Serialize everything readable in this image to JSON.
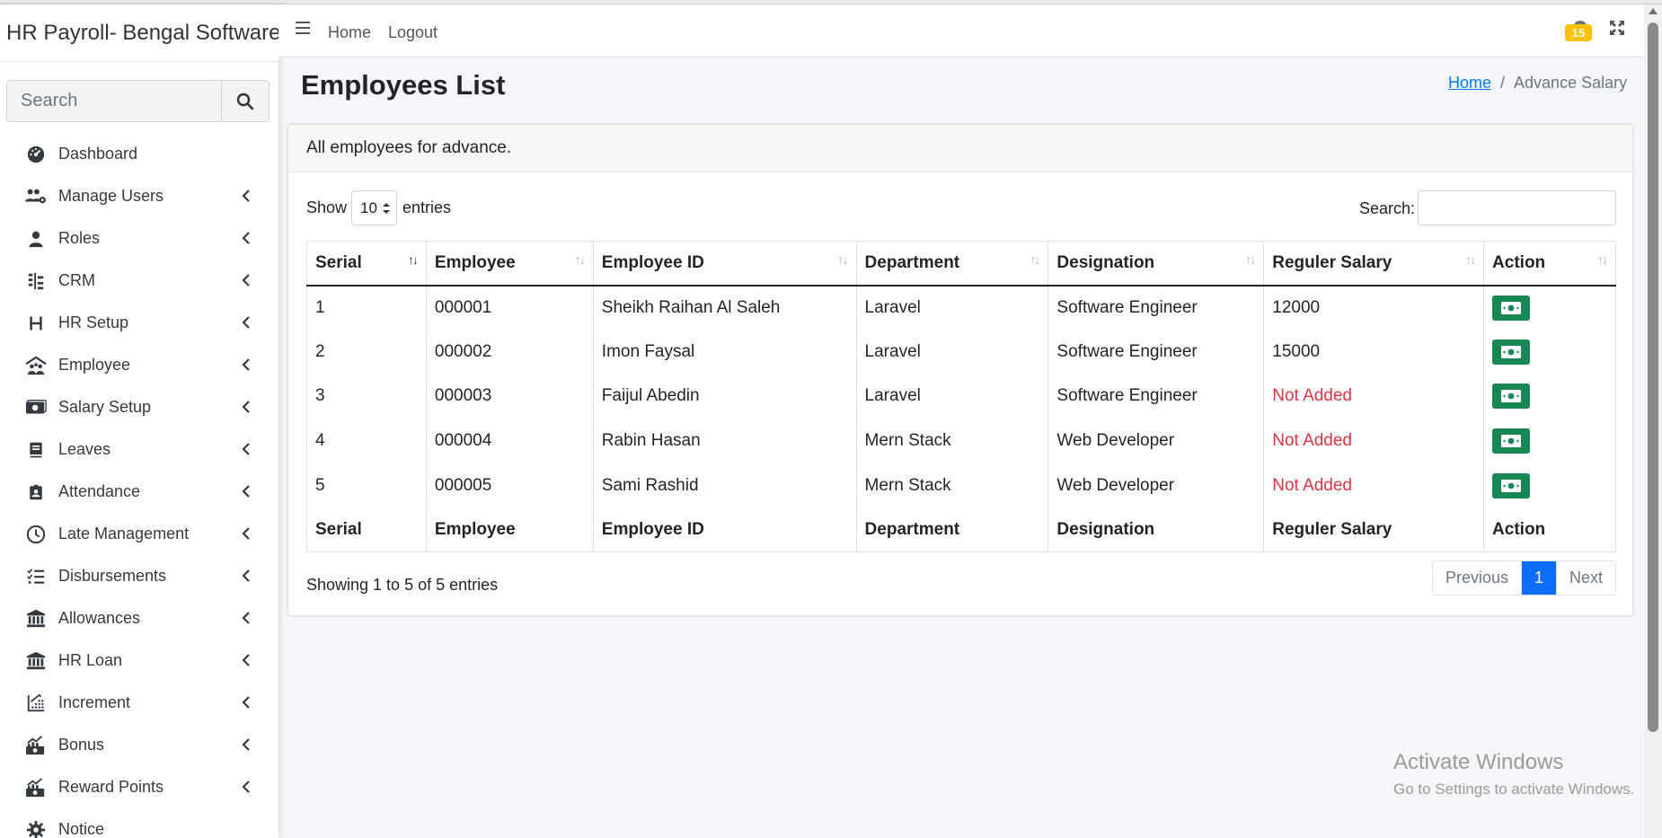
{
  "app": {
    "brand": "HR Payroll- Bengal Software"
  },
  "sidebar": {
    "search_placeholder": "Search",
    "items": [
      {
        "label": "Dashboard",
        "icon": "dashboard-icon",
        "has_submenu": false
      },
      {
        "label": "Manage Users",
        "icon": "users-icon",
        "has_submenu": true
      },
      {
        "label": "Roles",
        "icon": "user-icon",
        "has_submenu": true
      },
      {
        "label": "CRM",
        "icon": "sliders-icon",
        "has_submenu": true
      },
      {
        "label": "HR Setup",
        "icon": "h-icon",
        "has_submenu": true
      },
      {
        "label": "Employee",
        "icon": "people-roof-icon",
        "has_submenu": true
      },
      {
        "label": "Salary Setup",
        "icon": "money-bill-icon",
        "has_submenu": true
      },
      {
        "label": "Leaves",
        "icon": "book-icon",
        "has_submenu": true
      },
      {
        "label": "Attendance",
        "icon": "id-badge-icon",
        "has_submenu": true
      },
      {
        "label": "Late Management",
        "icon": "clock-icon",
        "has_submenu": true
      },
      {
        "label": "Disbursements",
        "icon": "list-check-icon",
        "has_submenu": true
      },
      {
        "label": "Allowances",
        "icon": "bank-icon",
        "has_submenu": true
      },
      {
        "label": "HR Loan",
        "icon": "bank-icon",
        "has_submenu": true
      },
      {
        "label": "Increment",
        "icon": "chart-scatter-icon",
        "has_submenu": true
      },
      {
        "label": "Bonus",
        "icon": "cash-chart-icon",
        "has_submenu": true
      },
      {
        "label": "Reward Points",
        "icon": "cash-chart-icon",
        "has_submenu": true
      },
      {
        "label": "Notice",
        "icon": "gear-icon",
        "has_submenu": false
      }
    ]
  },
  "navbar": {
    "links": [
      "Home",
      "Logout"
    ],
    "notification_count": "15"
  },
  "page": {
    "title": "Employees List",
    "breadcrumb": {
      "home": "Home",
      "current": "Advance Salary"
    }
  },
  "card": {
    "header": "All employees for advance.",
    "show_label": "Show",
    "entries_value": "10",
    "entries_label": "entries",
    "search_label": "Search:",
    "search_value": "",
    "columns": [
      "Serial",
      "Employee",
      "Employee ID",
      "Department",
      "Designation",
      "Reguler Salary",
      "Action"
    ],
    "rows": [
      {
        "serial": "1",
        "employee": "000001",
        "employee_id": "Sheikh Raihan Al Saleh",
        "department": "Laravel",
        "designation": "Software Engineer",
        "salary": "12000",
        "salary_missing": false
      },
      {
        "serial": "2",
        "employee": "000002",
        "employee_id": "Imon Faysal",
        "department": "Laravel",
        "designation": "Software Engineer",
        "salary": "15000",
        "salary_missing": false
      },
      {
        "serial": "3",
        "employee": "000003",
        "employee_id": "Faijul Abedin",
        "department": "Laravel",
        "designation": "Software Engineer",
        "salary": "Not Added",
        "salary_missing": true
      },
      {
        "serial": "4",
        "employee": "000004",
        "employee_id": "Rabin Hasan",
        "department": "Mern Stack",
        "designation": "Web Developer",
        "salary": "Not Added",
        "salary_missing": true
      },
      {
        "serial": "5",
        "employee": "000005",
        "employee_id": "Sami Rashid",
        "department": "Mern Stack",
        "designation": "Web Developer",
        "salary": "Not Added",
        "salary_missing": true
      }
    ],
    "info": "Showing 1 to 5 of 5 entries",
    "pagination": {
      "previous": "Previous",
      "current": "1",
      "next": "Next"
    }
  },
  "watermark": {
    "line1": "Activate Windows",
    "line2": "Go to Settings to activate Windows."
  },
  "colors": {
    "primary": "#0d6efd",
    "success": "#198754",
    "danger": "#dc3545",
    "warning": "#ffc107"
  }
}
